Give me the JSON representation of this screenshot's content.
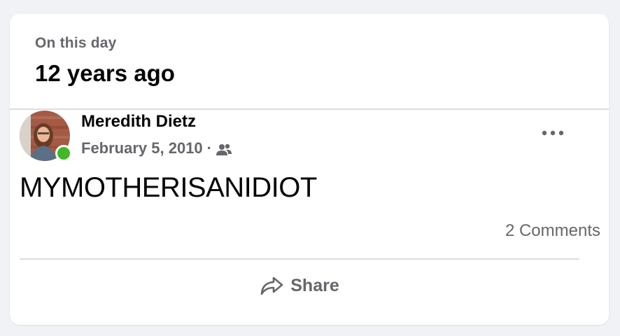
{
  "memory": {
    "eyebrow": "On this day",
    "years_ago": "12 years ago"
  },
  "post": {
    "author": "Meredith Dietz",
    "date": "February 5, 2010",
    "separator": "·",
    "audience_icon": "friends-icon",
    "text": "MYMOTHERISANIDIOT",
    "online": true,
    "more_icon": "more-options-icon"
  },
  "engagement": {
    "comments": "2 Comments"
  },
  "actions": {
    "share_label": "Share",
    "share_icon": "share-arrow-icon"
  },
  "colors": {
    "background": "#f0f2f5",
    "card": "#ffffff",
    "primary_text": "#050505",
    "secondary_text": "#65676b",
    "divider": "#dadde1",
    "online_green": "#42b72a"
  }
}
